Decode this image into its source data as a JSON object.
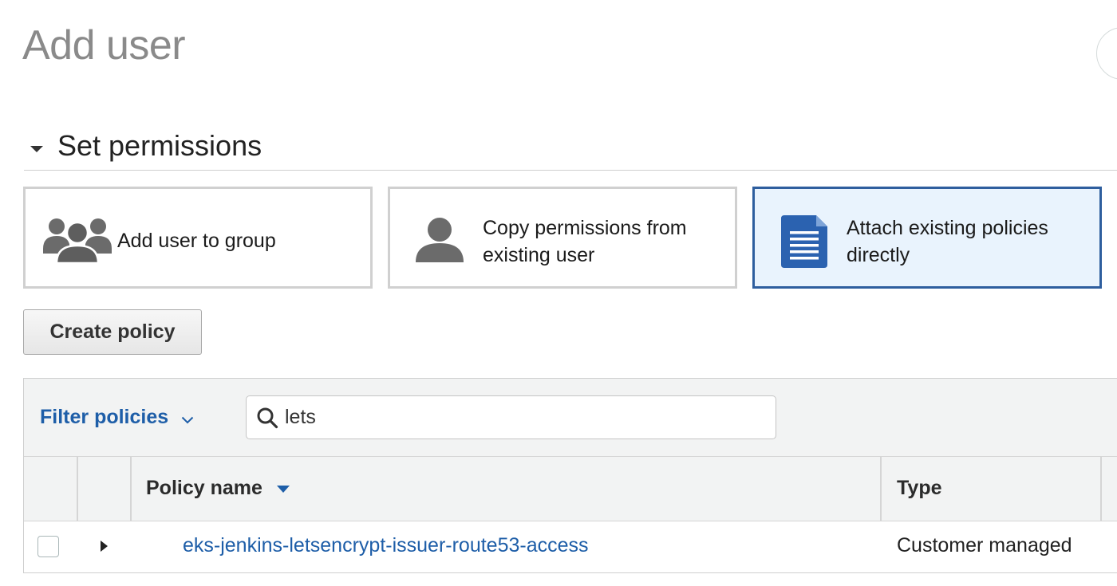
{
  "page": {
    "title": "Add user"
  },
  "section": {
    "title": "Set permissions"
  },
  "options": [
    {
      "label": "Add user to group",
      "icon": "group-icon",
      "selected": false
    },
    {
      "label": "Copy permissions from existing user",
      "icon": "user-icon",
      "selected": false
    },
    {
      "label": "Attach existing policies directly",
      "icon": "document-icon",
      "selected": true
    }
  ],
  "toolbar": {
    "create_policy_label": "Create policy"
  },
  "filter": {
    "label": "Filter policies",
    "search_value": "lets",
    "search_icon": "search-icon"
  },
  "table": {
    "columns": [
      "Policy name",
      "Type"
    ],
    "rows": [
      {
        "name": "eks-jenkins-letsencrypt-issuer-route53-access",
        "type": "Customer managed",
        "checked": false
      }
    ]
  },
  "colors": {
    "accent": "#1e5ea8",
    "selected_border": "#2e5e9e",
    "selected_bg": "#e9f3fd",
    "icon_gray": "#666666",
    "doc_blue": "#2b62b0"
  }
}
